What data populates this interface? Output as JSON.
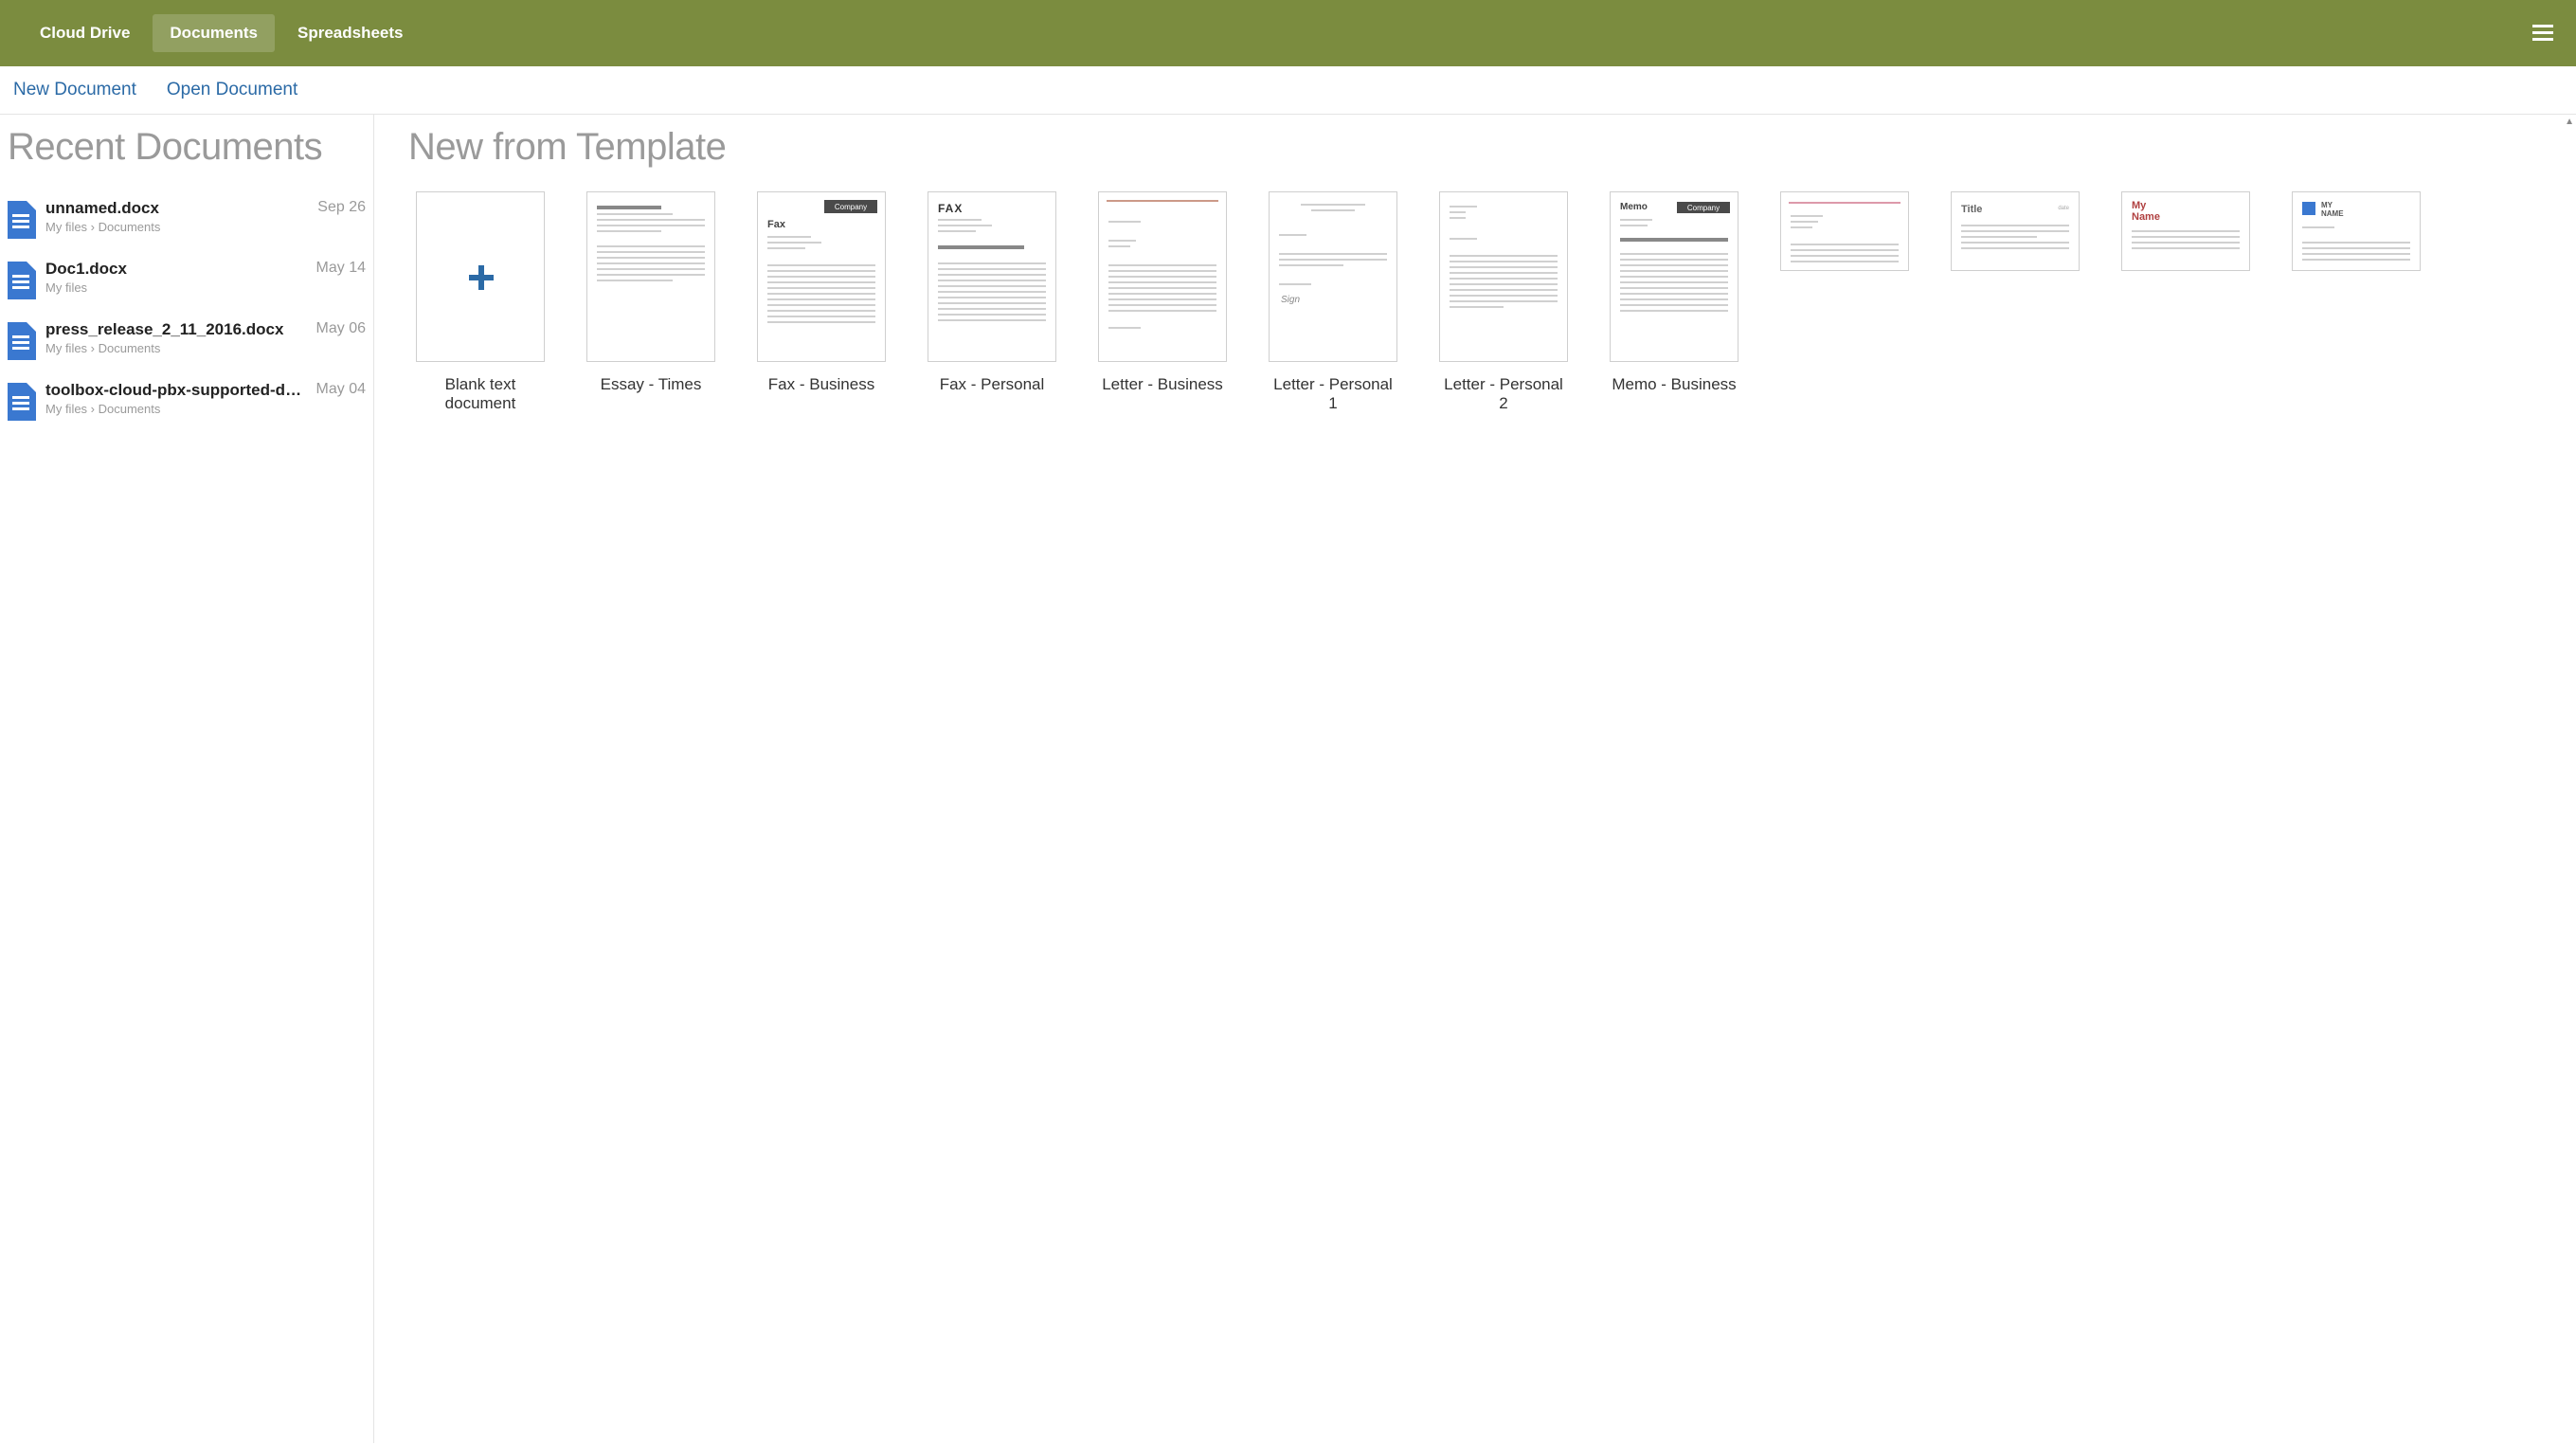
{
  "nav": {
    "items": [
      {
        "label": "Cloud Drive",
        "active": false
      },
      {
        "label": "Documents",
        "active": true
      },
      {
        "label": "Spreadsheets",
        "active": false
      }
    ]
  },
  "actions": {
    "new_document": "New Document",
    "open_document": "Open Document"
  },
  "sidebar": {
    "title": "Recent Documents",
    "items": [
      {
        "name": "unnamed.docx",
        "path": "My files › Documents",
        "date": "Sep 26"
      },
      {
        "name": "Doc1.docx",
        "path": "My files",
        "date": "May 14"
      },
      {
        "name": "press_release_2_11_2016.docx",
        "path": "My files › Documents",
        "date": "May 06"
      },
      {
        "name": "toolbox-cloud-pbx-supported-d…",
        "path": "My files › Documents",
        "date": "May 04"
      }
    ]
  },
  "templates": {
    "title": "New from Template",
    "items": [
      {
        "label": "Blank text document",
        "kind": "blank"
      },
      {
        "label": "Essay - Times",
        "kind": "essay"
      },
      {
        "label": "Fax - Business",
        "kind": "fax-business",
        "band_text": "Company",
        "header_text": "Fax"
      },
      {
        "label": "Fax - Personal",
        "kind": "fax-personal",
        "header_text": "FAX"
      },
      {
        "label": "Letter - Business",
        "kind": "letter-business"
      },
      {
        "label": "Letter - Personal 1",
        "kind": "letter-personal-1"
      },
      {
        "label": "Letter - Personal 2",
        "kind": "letter-personal-2"
      },
      {
        "label": "Memo - Business",
        "kind": "memo-business",
        "band_text": "Company",
        "header_text": "Memo"
      },
      {
        "label": "",
        "kind": "partial-1"
      },
      {
        "label": "",
        "kind": "partial-2",
        "header_text": "Title"
      },
      {
        "label": "",
        "kind": "partial-3",
        "header_text": "My\nName"
      },
      {
        "label": "",
        "kind": "partial-4",
        "header_text": "MY\nNAME"
      }
    ]
  }
}
